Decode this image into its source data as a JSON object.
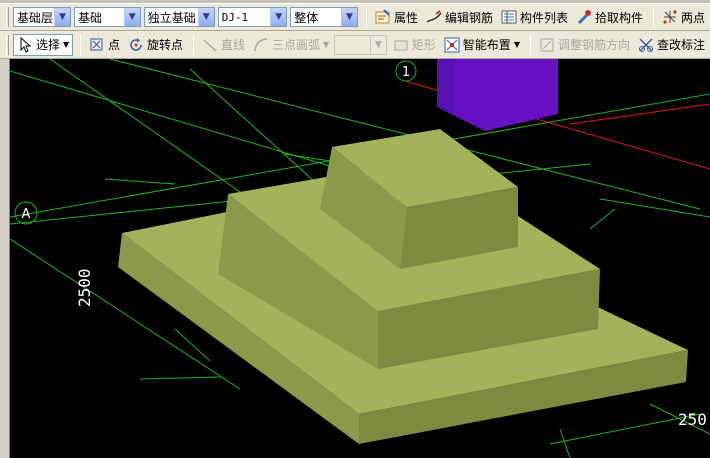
{
  "toolbar1": {
    "floor": "基础层",
    "category": "基础",
    "component_type": "独立基础",
    "component": "DJ-1",
    "scope": "整体",
    "attributes_label": "属性",
    "edit_rebar_label": "编辑钢筋",
    "component_list_label": "构件列表",
    "pick_component_label": "拾取构件",
    "two_points_label": "两点"
  },
  "toolbar2": {
    "select_label": "选择",
    "point_label": "点",
    "rotate_point_label": "旋转点",
    "line_label": "直线",
    "arc_label": "三点画弧",
    "rect_label": "矩形",
    "smart_layout_label": "智能布置",
    "adjust_rebar_label": "调整钢筋方向",
    "check_dim_label": "查改标注"
  },
  "viewport": {
    "axis_1": "1",
    "axis_a": "A",
    "dim_left": "2500",
    "dim_right": "250",
    "colors": {
      "background": "#000000",
      "grid_line": "#1fb51f",
      "axis_red": "#e01818",
      "column": "#6611c4",
      "footing_top": "#a3b35c",
      "footing_side_light": "#8b9a4a",
      "footing_side_dark": "#6e7a37"
    }
  }
}
